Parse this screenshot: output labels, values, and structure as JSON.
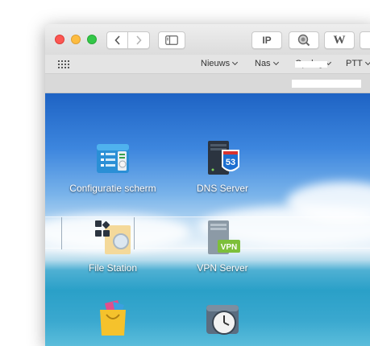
{
  "toolbar": {
    "back_icon": "chevron-left-icon",
    "forward_icon": "chevron-right-icon",
    "sidebar_icon": "sidebar-icon",
    "ip_label": "IP",
    "w_label": "W"
  },
  "bookmarks": {
    "items": [
      {
        "label": "Nieuws"
      },
      {
        "label": "Nas"
      },
      {
        "label": "Opslag"
      },
      {
        "label": "PTT"
      }
    ]
  },
  "apps": [
    {
      "label": "Configuratie scherm",
      "icon": "control-panel-icon"
    },
    {
      "label": "DNS Server",
      "icon": "dns-server-icon",
      "badge": "53"
    },
    {
      "label": "File Station",
      "icon": "file-station-icon"
    },
    {
      "label": "VPN Server",
      "icon": "vpn-server-icon",
      "badge": "VPN"
    },
    {
      "label": "",
      "icon": "package-center-icon"
    },
    {
      "label": "",
      "icon": "time-backup-icon"
    }
  ],
  "colors": {
    "desktop_top": "#1e63c4",
    "sea": "#2aa0c8",
    "dns_badge": "#1d6fd1",
    "vpn_badge": "#7dbf3a"
  }
}
